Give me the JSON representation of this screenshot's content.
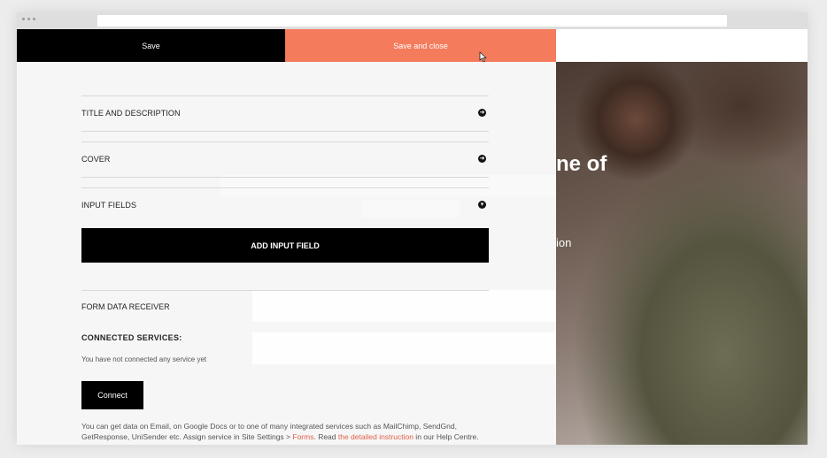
{
  "toolbar": {
    "save_label": "Save",
    "save_close_label": "Save and close"
  },
  "preview": {
    "heading": "ne of",
    "subtext": "ion"
  },
  "form": {
    "sections": [
      {
        "label": "TITLE AND DESCRIPTION",
        "icon": "arrow-right-circle-icon"
      },
      {
        "label": "COVER",
        "icon": "arrow-right-circle-icon"
      },
      {
        "label": "INPUT FIELDS",
        "icon": "arrow-down-circle-icon"
      }
    ],
    "add_input_field_label": "ADD INPUT FIELD",
    "form_data_receiver_label": "FORM DATA RECEIVER",
    "connected_services_label": "CONNECTED SERVICES:",
    "no_services_text": "You have not connected any service yet",
    "connect_label": "Connect",
    "help": {
      "part1": "You can get data on Email, on Google Docs or to one of many integrated services such as MailChimp, SendGnd, GetResponse, UniSender etc. Assign service in Site Settings > ",
      "forms_link": "Forms",
      "part2": ". Read ",
      "instruction_link": "the detailed instruction",
      "part3": " in our Help Centre."
    }
  },
  "colors": {
    "accent": "#f47b5c",
    "dark": "#000000",
    "panel_bg": "#f6f6f6",
    "link": "#e0604a"
  }
}
